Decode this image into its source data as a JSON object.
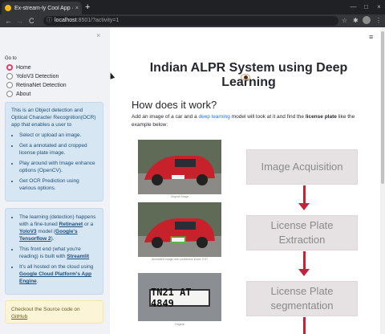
{
  "browser": {
    "tab_title": "Ex-stream-ly Cool App · Stre",
    "tab_close": "×",
    "new_tab": "+",
    "url_host": "localhost",
    "url_path": ":8501/?activity=1",
    "back": "←",
    "forward": "→",
    "reload": "C",
    "min": "—",
    "max": "□",
    "close": "×"
  },
  "sidebar": {
    "close_icon": "×",
    "goto_label": "Go to",
    "options": [
      "Home",
      "YoloV3 Detection",
      "RetinaNet Detection",
      "About"
    ],
    "selected": "Home",
    "info1": {
      "text": "This is an Object detection and Optical Character Recognition(OCR) app that enables a user to",
      "bullets": [
        "Select or upload an image.",
        "Get a annotated and cropped license plate image.",
        "Play around with Image enhance options (OpenCV).",
        "Get OCR Prediction using various options."
      ]
    },
    "info2": {
      "b1_pre": "The learning (detection) happens with a fine-tuned ",
      "b1_link1": "Retinanet",
      "b1_mid": " or a ",
      "b1_link2": "YoloV3",
      "b1_post": " model (",
      "b1_link3": "Google's Tensorflow 2",
      "b1_end": ").",
      "b2_pre": "This front end (what you're reading) is built with ",
      "b2_link": "Streamlit",
      "b3_pre": "It's all hosted on the cloud using ",
      "b3_link": "Google Cloud Platform's App Engine",
      "b3_end": "."
    },
    "warn": {
      "text": "Checkout the Source code on ",
      "link": "GitHub"
    }
  },
  "main": {
    "menu_icon": "≡",
    "title": "Indian ALPR System using Deep Learning",
    "section": "How does it work?",
    "para_pre": "Add an image of a car and a ",
    "para_link": "deep learning",
    "para_mid": " model will look at it and find the ",
    "para_bold": "license plate",
    "para_post": " like the example below:",
    "captions": [
      "Original Image",
      "Annotated Image with confidence score: 0.97",
      "Original"
    ],
    "plate_text": "TN21 AT 4849",
    "flow": [
      "Image Acquisition",
      "License Plate Extraction",
      "License Plate segmentation"
    ]
  },
  "colors": {
    "accent": "#f63366",
    "arrow": "#c3243b",
    "info_bg": "#d6e6f2",
    "warn_bg": "#fbf4d7"
  }
}
